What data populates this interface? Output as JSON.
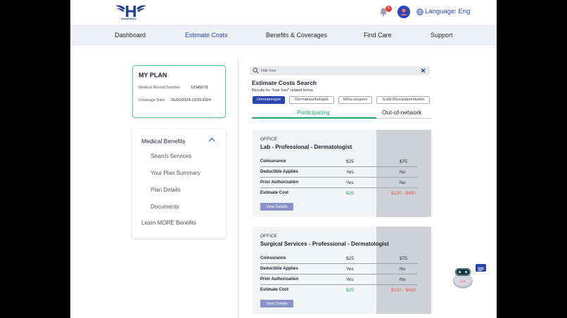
{
  "header": {
    "logo_text": "HealthHere",
    "notification_count": "0",
    "language_label": "Language: Eng"
  },
  "nav": {
    "items": [
      {
        "label": "Dashboard"
      },
      {
        "label": "Estimate Costs"
      },
      {
        "label": "Benefits & Coverages"
      },
      {
        "label": "Find Care"
      },
      {
        "label": "Support"
      }
    ],
    "active": "Estimate Costs"
  },
  "plan": {
    "title": "MY PLAN",
    "record_label": "Medical Record Number",
    "record_value": "12345678",
    "coverage_label": "Coverage Date:",
    "coverage_value": "01/01/2024-12/31/2024"
  },
  "benefits": {
    "heading": "Medical Benefits",
    "items": [
      "Search Services",
      "Your Plan Summary",
      "Plan Details",
      "Documents"
    ],
    "learn_more": "Learn MORE Benefits"
  },
  "search": {
    "value": "Hair loss",
    "title": "Estimate Costs Search",
    "results_text": "Results for \"Hair loss\" related terms",
    "chips": [
      "Dermatologist",
      "Dermatopathologist",
      "Mohs surgeon",
      "Scalp Micropigmentation"
    ],
    "active_chip": "Dermatologist"
  },
  "tabs": {
    "participating": "Participating",
    "out_of_network": "Out-of-network"
  },
  "cards": [
    {
      "type": "OFFICE",
      "service": "Lab - Professional - Dermatologist",
      "rows": [
        {
          "label": "Coinsurance",
          "participating": "$25",
          "out": "$75"
        },
        {
          "label": "Deductible Applies",
          "participating": "Yes",
          "out": "No"
        },
        {
          "label": "Prior Authorization",
          "participating": "Yes",
          "out": "No"
        },
        {
          "label": "Estimate Cost",
          "participating": "$25",
          "out": "$120 - $450"
        }
      ],
      "button": "View Details"
    },
    {
      "type": "OFFICE",
      "service": "Surgical Services - Professional - Dermatologist",
      "rows": [
        {
          "label": "Coinsurance",
          "participating": "$25",
          "out": "$75"
        },
        {
          "label": "Deductible Applies",
          "participating": "Yes",
          "out": "No"
        },
        {
          "label": "Prior Authorization",
          "participating": "Yes",
          "out": "No"
        },
        {
          "label": "Estimate Cost",
          "participating": "$25",
          "out": "$120 - $450"
        }
      ],
      "button": "View Details"
    }
  ],
  "colors": {
    "primary": "#2a45b0",
    "accent_green": "#2aa36b",
    "out_of_network_red": "#e0544a",
    "nav_bg": "#eef0f5"
  },
  "icons": {
    "logo": "healthhere-winged-h-logo",
    "notifications": "bell-icon",
    "profile": "avatar",
    "language": "globe-icon",
    "search": "search-icon",
    "clear": "close-icon",
    "collapse": "chevron-up-icon",
    "chat": "chat-icon",
    "assistant": "bot-mascot"
  }
}
